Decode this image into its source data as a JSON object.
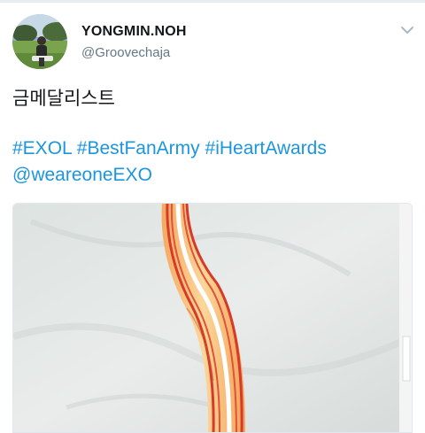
{
  "user": {
    "display_name": "YONGMIN.NOH",
    "handle": "@Groovechaja"
  },
  "icons": {
    "avatar": "avatar",
    "menu": "chevron-down-icon"
  },
  "tweet": {
    "text": "금메달리스트",
    "hashtags": [
      "#EXOL",
      "#BestFanArmy",
      "#iHeartAwards"
    ],
    "mention": "@weareoneEXO"
  },
  "colors": {
    "link": "#1b95e0",
    "name": "#14171a",
    "handle": "#657786"
  }
}
